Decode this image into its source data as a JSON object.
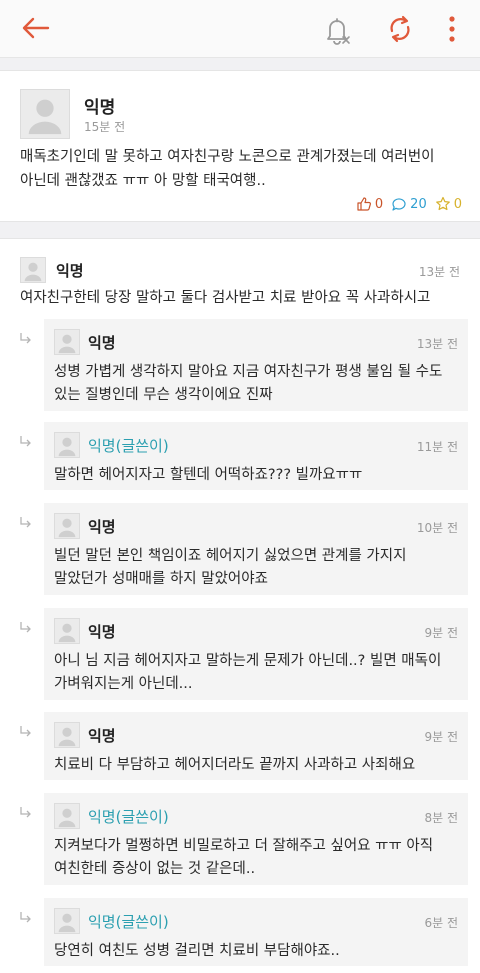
{
  "post": {
    "author": "익명",
    "time": "15분 전",
    "body": "매독초기인데 말 못하고 여자친구랑 노콘으로 관계가졌는데 여러번이\n아닌데 괜찮갰죠 ㅠㅠ 아 망할 태국여행..",
    "likes": "0",
    "comments": "20",
    "scraps": "0"
  },
  "comments": [
    {
      "author": "익명",
      "time": "13분 전",
      "text": "여자친구한테 당장 말하고 둘다 검사받고 치료 받아요 꼭 사과하시고",
      "reply": false,
      "is_op": false
    },
    {
      "author": "익명",
      "time": "13분 전",
      "text": "성병 가볍게 생각하지 말아요 지금 여자친구가 평생 불임 될 수도\n있는 질병인데 무슨 생각이에요 진짜",
      "reply": true,
      "is_op": false
    },
    {
      "author": "익명(글쓴이)",
      "time": "11분 전",
      "text": "말하면 헤어지자고 할텐데 어떡하죠??? 빌까요ㅠㅠ",
      "reply": true,
      "is_op": true
    },
    {
      "author": "익명",
      "time": "10분 전",
      "text": "빌던 말던 본인 책임이죠 헤어지기 싫었으면 관계를 가지지\n말았던가 성매매를 하지 말았어야죠",
      "reply": true,
      "is_op": false
    },
    {
      "author": "익명",
      "time": "9분 전",
      "text": "아니 님 지금 헤어지자고 말하는게 문제가 아닌데..? 빌면 매독이\n가벼워지는게 아닌데...",
      "reply": true,
      "is_op": false
    },
    {
      "author": "익명",
      "time": "9분 전",
      "text": "치료비 다 부담하고 헤어지더라도 끝까지 사과하고 사죄해요",
      "reply": true,
      "is_op": false
    },
    {
      "author": "익명(글쓴이)",
      "time": "8분 전",
      "text": "지켜보다가 멀쩡하면 비밀로하고 더 잘해주고 싶어요 ㅠㅠ 아직\n여친한테 증상이 없는 것 같은데..",
      "reply": true,
      "is_op": true
    },
    {
      "author": "익명(글쓴이)",
      "time": "6분 전",
      "text": "당연히 여친도 성병 걸리면 치료비 부담해야죠..",
      "reply": true,
      "is_op": true
    }
  ],
  "colors": {
    "accent": "#e0593a",
    "op_name": "#2b9fb0",
    "comment_count": "#2f9fd1",
    "scrap": "#d7b22d"
  },
  "icons": {
    "back": "arrow-left-icon",
    "notify": "bell-off-icon",
    "refresh": "refresh-icon",
    "more": "more-vertical-icon"
  }
}
